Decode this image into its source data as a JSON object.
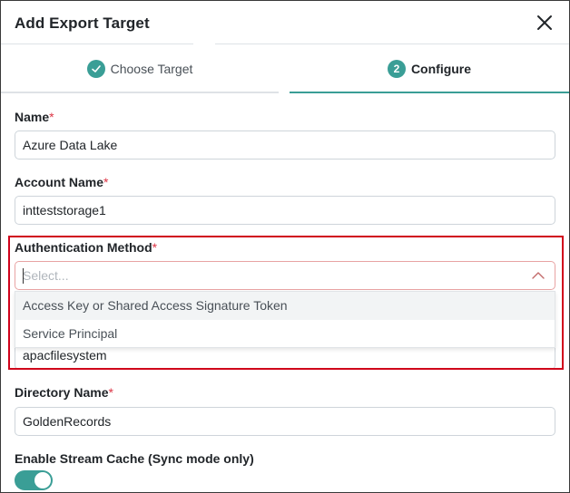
{
  "dialog": {
    "title": "Add Export Target"
  },
  "steps": [
    {
      "label": "Choose Target",
      "state": "completed",
      "icon": "check-icon"
    },
    {
      "label": "Configure",
      "number": "2",
      "state": "active"
    }
  ],
  "form": {
    "name": {
      "label": "Name",
      "required": "*",
      "value": "Azure Data Lake"
    },
    "account_name": {
      "label": "Account Name",
      "required": "*",
      "value": "intteststorage1"
    },
    "auth_method": {
      "label": "Authentication Method",
      "required": "*",
      "placeholder": "Select...",
      "options": [
        "Access Key or Shared Access Signature Token",
        "Service Principal"
      ]
    },
    "file_system": {
      "value": "apacfilesystem"
    },
    "directory_name": {
      "label": "Directory Name",
      "required": "*",
      "value": "GoldenRecords"
    },
    "stream_cache": {
      "label": "Enable Stream Cache (Sync mode only)",
      "enabled": true
    }
  },
  "colors": {
    "accent": "#3a9e96",
    "required": "#dc3545",
    "highlight": "#d0021b"
  }
}
